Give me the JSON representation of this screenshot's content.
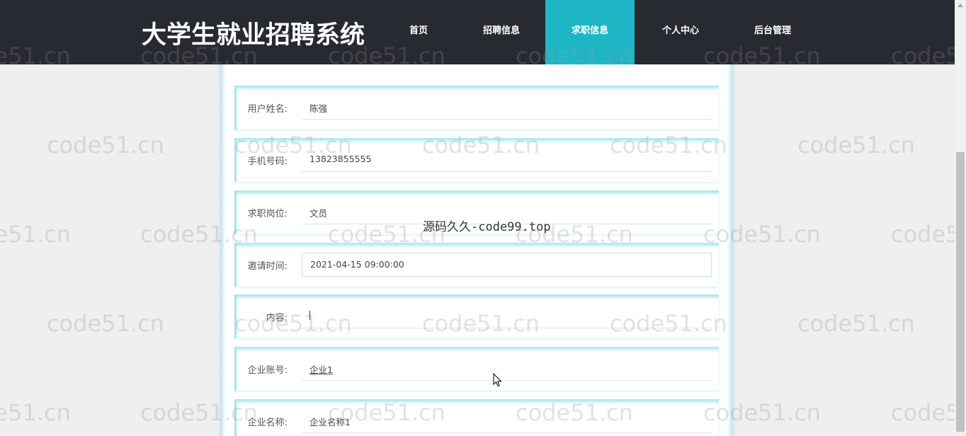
{
  "header": {
    "title": "大学生就业招聘系统",
    "nav": [
      {
        "label": "首页",
        "active": false
      },
      {
        "label": "招聘信息",
        "active": false
      },
      {
        "label": "求职信息",
        "active": true
      },
      {
        "label": "个人中心",
        "active": false
      },
      {
        "label": "后台管理",
        "active": false
      }
    ]
  },
  "form": {
    "rows": [
      {
        "label": "用户姓名:",
        "value": "陈强"
      },
      {
        "label": "手机号码:",
        "value": "13823855555"
      },
      {
        "label": "求职岗位:",
        "value": "文员"
      },
      {
        "label": "邀请时间:",
        "value": "2021-04-15 09:00:00"
      },
      {
        "label": "内容:",
        "value": ""
      },
      {
        "label": "企业账号:",
        "value": "企业1"
      },
      {
        "label": "企业名称:",
        "value": "企业名称1"
      }
    ]
  },
  "watermark": {
    "repeat_text": "code51.cn",
    "center_text": "源码久久-code99.top"
  },
  "colors": {
    "header_bg": "#272a30",
    "nav_active_bg": "#1eb5c4",
    "row_accent": "#a9e6ea"
  }
}
